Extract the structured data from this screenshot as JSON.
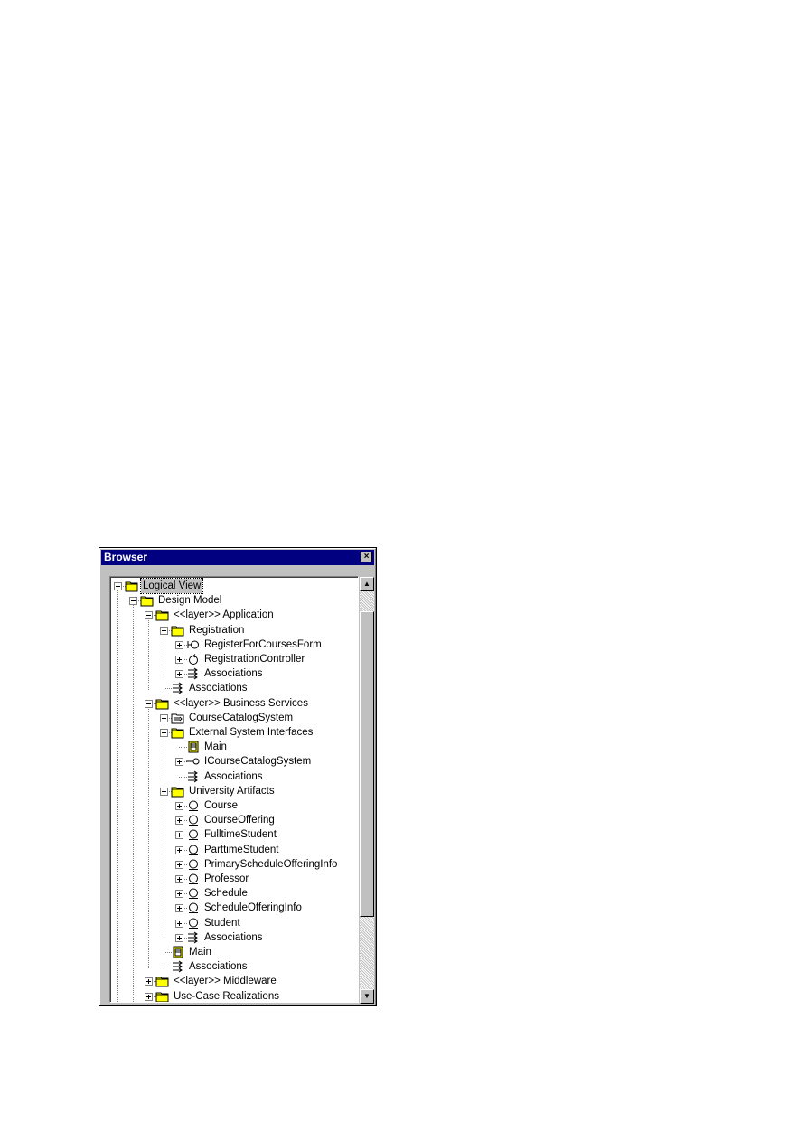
{
  "window": {
    "title": "Browser",
    "close_glyph": "×"
  },
  "tree": {
    "nodes": [
      {
        "label": "Logical View",
        "icon": "folder-icon",
        "toggle": "minus"
      },
      {
        "label": "Design Model",
        "icon": "folder-icon",
        "toggle": "minus"
      },
      {
        "label": "<<layer>> Application",
        "icon": "folder-icon",
        "toggle": "minus"
      },
      {
        "label": "Registration",
        "icon": "folder-icon",
        "toggle": "minus"
      },
      {
        "label": "RegisterForCoursesForm",
        "icon": "boundary-class-icon",
        "toggle": "plus"
      },
      {
        "label": "RegistrationController",
        "icon": "control-class-icon",
        "toggle": "plus"
      },
      {
        "label": "Associations",
        "icon": "associations-icon",
        "toggle": "plus"
      },
      {
        "label": "Associations",
        "icon": "associations-icon",
        "toggle": "none"
      },
      {
        "label": "<<layer>> Business Services",
        "icon": "folder-icon",
        "toggle": "minus"
      },
      {
        "label": "CourseCatalogSystem",
        "icon": "subsystem-icon",
        "toggle": "plus"
      },
      {
        "label": "External System Interfaces",
        "icon": "folder-icon",
        "toggle": "minus"
      },
      {
        "label": "Main",
        "icon": "class-diagram-icon",
        "toggle": "none"
      },
      {
        "label": "ICourseCatalogSystem",
        "icon": "interface-icon",
        "toggle": "plus"
      },
      {
        "label": "Associations",
        "icon": "associations-icon",
        "toggle": "none"
      },
      {
        "label": "University Artifacts",
        "icon": "folder-icon",
        "toggle": "minus"
      },
      {
        "label": "Course",
        "icon": "entity-class-icon",
        "toggle": "plus"
      },
      {
        "label": "CourseOffering",
        "icon": "entity-class-icon",
        "toggle": "plus"
      },
      {
        "label": "FulltimeStudent",
        "icon": "entity-class-icon",
        "toggle": "plus"
      },
      {
        "label": "ParttimeStudent",
        "icon": "entity-class-icon",
        "toggle": "plus"
      },
      {
        "label": "PrimaryScheduleOfferingInfo",
        "icon": "entity-class-icon",
        "toggle": "plus"
      },
      {
        "label": "Professor",
        "icon": "entity-class-icon",
        "toggle": "plus"
      },
      {
        "label": "Schedule",
        "icon": "entity-class-icon",
        "toggle": "plus"
      },
      {
        "label": "ScheduleOfferingInfo",
        "icon": "entity-class-icon",
        "toggle": "plus"
      },
      {
        "label": "Student",
        "icon": "entity-class-icon",
        "toggle": "plus"
      },
      {
        "label": "Associations",
        "icon": "associations-icon",
        "toggle": "plus"
      },
      {
        "label": "Main",
        "icon": "class-diagram-icon",
        "toggle": "none"
      },
      {
        "label": "Associations",
        "icon": "associations-icon",
        "toggle": "none"
      },
      {
        "label": "<<layer>> Middleware",
        "icon": "folder-icon",
        "toggle": "plus"
      },
      {
        "label": "Use-Case Realizations",
        "icon": "folder-icon",
        "toggle": "plus"
      }
    ]
  },
  "colors": {
    "title_bar": "#000080",
    "folder": "#ffff00",
    "selection": "#c0c0c0"
  }
}
